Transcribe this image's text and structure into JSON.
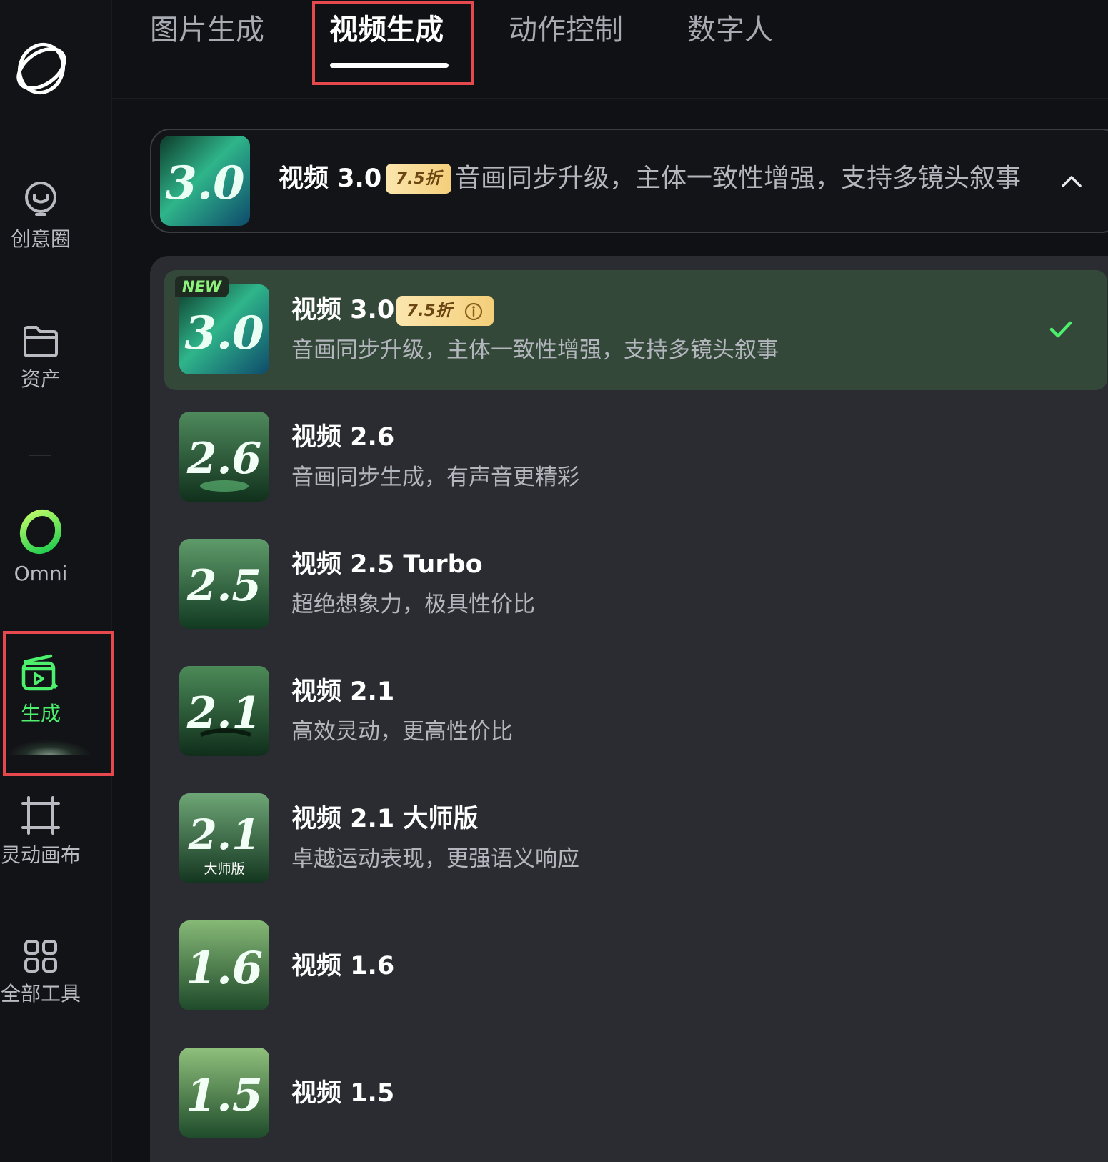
{
  "sidebar": {
    "items": [
      {
        "label": "创意圈",
        "icon": "lightbulb-smile-icon"
      },
      {
        "label": "资产",
        "icon": "folder-icon"
      },
      {
        "label": "Omni",
        "icon": "omni-ring-icon"
      },
      {
        "label": "生成",
        "icon": "clapper-generate-icon",
        "active": true
      },
      {
        "label": "灵动画布",
        "icon": "canvas-crop-icon"
      },
      {
        "label": "全部工具",
        "icon": "grid-tools-icon"
      }
    ]
  },
  "tabs": [
    {
      "label": "图片生成"
    },
    {
      "label": "视频生成",
      "active": true
    },
    {
      "label": "动作控制"
    },
    {
      "label": "数字人"
    }
  ],
  "selector": {
    "thumb_text": "3.0",
    "title": "视频 3.0",
    "badge": "7.5折",
    "description": "音画同步升级，主体一致性增强，支持多镜头叙事",
    "expanded": true
  },
  "models": [
    {
      "thumb_text": "3.0",
      "title": "视频 3.0",
      "badge": "7.5折",
      "new_tag": "NEW",
      "description": "音画同步升级，主体一致性增强，支持多镜头叙事",
      "selected": true
    },
    {
      "thumb_text": "2.6",
      "title": "视频 2.6",
      "description": "音画同步生成，有声音更精彩"
    },
    {
      "thumb_text": "2.5",
      "title": "视频 2.5 Turbo",
      "description": "超绝想象力，极具性价比"
    },
    {
      "thumb_text": "2.1",
      "title": "视频 2.1",
      "description": "高效灵动，更高性价比"
    },
    {
      "thumb_text": "2.1",
      "thumb_sub": "大师版",
      "title": "视频 2.1 大师版",
      "description": "卓越运动表现，更强语义响应"
    },
    {
      "thumb_text": "1.6",
      "title": "视频 1.6"
    },
    {
      "thumb_text": "1.5",
      "title": "视频 1.5"
    }
  ],
  "colors": {
    "accent_green": "#4cf06d",
    "highlight_red": "#e5484d",
    "badge_gold": "#f4cf7a",
    "selected_row": "#34483a"
  }
}
